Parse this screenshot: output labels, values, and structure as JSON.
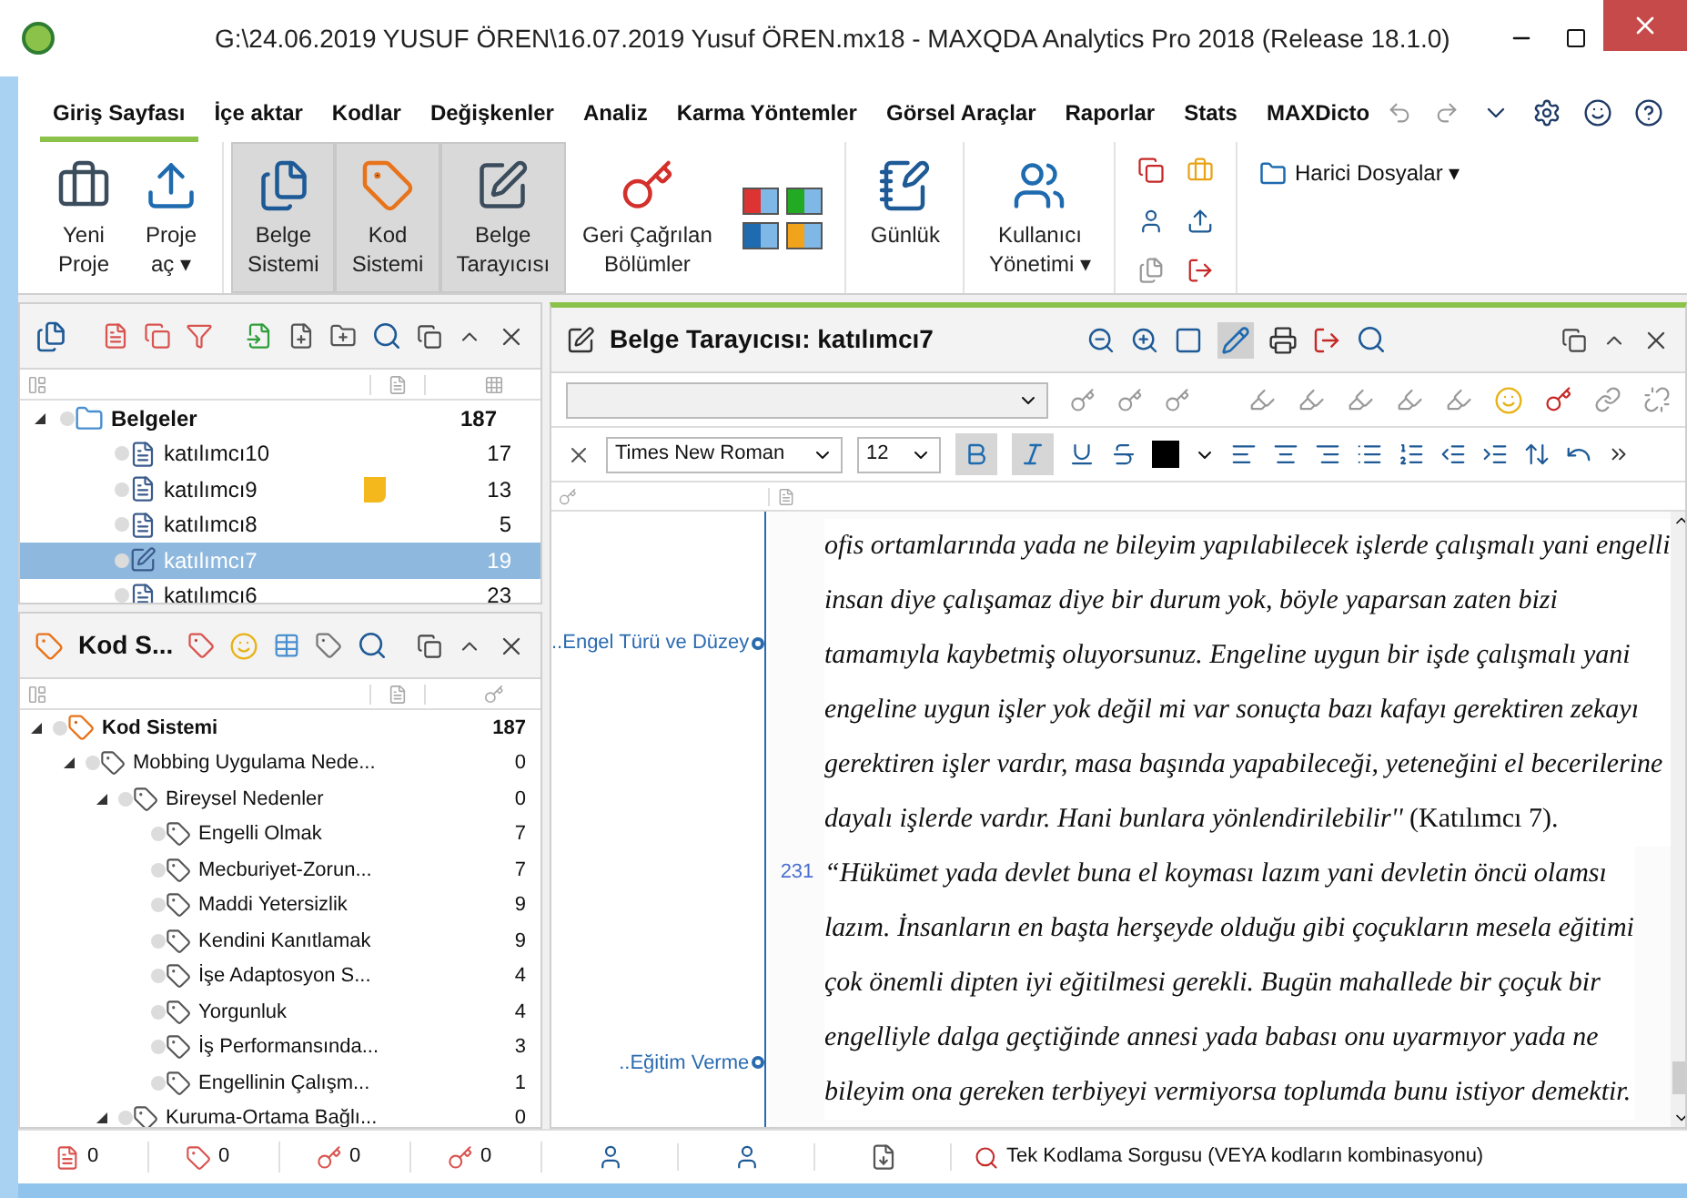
{
  "window": {
    "title": "G:\\24.06.2019 YUSUF ÖREN\\16.07.2019 Yusuf ÖREN.mx18 - MAXQDA Analytics Pro 2018  (Release 18.1.0)"
  },
  "tabs": [
    {
      "label": "Giriş Sayfası",
      "selected": true
    },
    {
      "label": "İçe aktar",
      "selected": false
    },
    {
      "label": "Kodlar",
      "selected": false
    },
    {
      "label": "Değişkenler",
      "selected": false
    },
    {
      "label": "Analiz",
      "selected": false
    },
    {
      "label": "Karma Yöntemler",
      "selected": false
    },
    {
      "label": "Görsel Araçlar",
      "selected": false
    },
    {
      "label": "Raporlar",
      "selected": false
    },
    {
      "label": "Stats",
      "selected": false
    },
    {
      "label": "MAXDicto",
      "selected": false
    }
  ],
  "ribbon": {
    "groups": [
      [
        {
          "kind": "new-project",
          "label": [
            "Yeni",
            "Proje"
          ],
          "selected": false
        },
        {
          "kind": "open-project",
          "label": [
            "Proje",
            "aç"
          ],
          "selected": false,
          "menu": "▾"
        }
      ],
      [
        {
          "kind": "doc-system",
          "label": [
            "Belge",
            "Sistemi"
          ],
          "selected": true
        },
        {
          "kind": "code-system",
          "label": [
            "Kod",
            "Sistemi"
          ],
          "selected": true
        },
        {
          "kind": "doc-browser",
          "label": [
            "Belge",
            "Tarayıcısı"
          ],
          "selected": true
        },
        {
          "kind": "retrieved",
          "label": [
            "Geri Çağrılan",
            "Bölümler"
          ],
          "selected": false
        },
        {
          "kind": "layout-grid"
        }
      ],
      [
        {
          "kind": "logbook",
          "label": [
            "Günlük"
          ],
          "selected": false
        }
      ],
      [
        {
          "kind": "users",
          "label": [
            "Kullanıcı",
            "Yönetimi"
          ],
          "selected": false,
          "menu": "▾"
        }
      ]
    ],
    "external_files": {
      "label": "Harici Dosyalar",
      "menu": "▾"
    }
  },
  "documents": {
    "root": {
      "label": "Belgeler",
      "count": "187",
      "expanded": true
    },
    "items": [
      {
        "label": "katılımcı10",
        "count": "17",
        "memo": false,
        "selected": false
      },
      {
        "label": "katılımcı9",
        "count": "13",
        "memo": true,
        "selected": false
      },
      {
        "label": "katılımcı8",
        "count": "5",
        "memo": false,
        "selected": false
      },
      {
        "label": "katılımcı7",
        "count": "19",
        "memo": false,
        "selected": true
      },
      {
        "label": "katılımcı6",
        "count": "23",
        "memo": false,
        "selected": false
      }
    ]
  },
  "codes": {
    "title": "Kod S...",
    "tree": [
      {
        "label": "Kod Sistemi",
        "count": "187",
        "expanded": true,
        "children": [
          {
            "label": "Mobbing Uygulama Nede...",
            "count": "0",
            "expanded": true,
            "children": [
              {
                "label": "Bireysel Nedenler",
                "count": "0",
                "expanded": true,
                "children": [
                  {
                    "label": "Engelli Olmak",
                    "count": "7"
                  },
                  {
                    "label": "Mecburiyet-Zorun...",
                    "count": "7"
                  },
                  {
                    "label": "Maddi Yetersizlik",
                    "count": "9"
                  },
                  {
                    "label": "Kendini Kanıtlamak",
                    "count": "9"
                  },
                  {
                    "label": "İşe Adaptosyon S...",
                    "count": "4"
                  },
                  {
                    "label": "Yorgunluk",
                    "count": "4"
                  },
                  {
                    "label": "İş Performansında...",
                    "count": "3"
                  },
                  {
                    "label": "Engellinin Çalışm...",
                    "count": "1"
                  }
                ]
              },
              {
                "label": "Kuruma-Ortama Bağlı...",
                "count": "0",
                "expanded": true
              }
            ]
          }
        ]
      }
    ]
  },
  "counters": [
    "0",
    "0",
    "0",
    "0"
  ],
  "browser": {
    "title": "Belge Tarayıcısı: katılımcı7",
    "font": "Times New Roman",
    "size": "12",
    "bold": true,
    "italic": true,
    "codes": [
      {
        "label": "..Engel Türü ve Düzey"
      },
      {
        "label": "..Eğitim Verme"
      }
    ],
    "paragraphs": [
      {
        "lines": [
          {
            "text": "ofis ortamlarında yada ne bileyim yapılabilecek işlerde çalışmalı yani engelli",
            "italic": true
          },
          {
            "text": "insan diye çalışamaz diye bir durum yok, böyle yaparsan zaten bizi",
            "italic": true
          },
          {
            "text": "tamamıyla kaybetmiş oluyorsunuz. Engeline uygun bir işde çalışmalı yani",
            "italic": true
          },
          {
            "text": "engeline uygun işler yok değil mi var sonuçta bazı kafayı gerektiren zekayı",
            "italic": true
          },
          {
            "text": "gerektiren işler vardır, masa başında yapabileceği, yeteneğini el becerilerine",
            "italic": true
          },
          {
            "text": "*dayalı işlerde vardır. Hani bunlara yönlendirilebilir''* (Katılımcı 7).",
            "italic": false
          }
        ]
      },
      {
        "number": "231",
        "lines": [
          {
            "text": "“Hükümet yada devlet buna el koyması lazım yani devletin öncü olamsı",
            "italic": true
          },
          {
            "text": "lazım. İnsanların en başta herşeyde olduğu  gibi çoçukların mesela eğitimi",
            "italic": true
          },
          {
            "text": "çok önemli dipten iyi eğitilmesi gerekli. Bugün mahallede bir çoçuk bir",
            "italic": true
          },
          {
            "text": "engelliyle dalga geçtiğinde annesi yada babası onu uyarmıyor yada ne",
            "italic": true
          },
          {
            "text": "bileyim ona gereken terbiyeyi vermiyorsa toplumda bunu istiyor demektir.",
            "italic": true
          }
        ]
      }
    ]
  },
  "status": {
    "query": "Tek Kodlama Sorgusu (VEYA kodların kombinasyonu)"
  }
}
